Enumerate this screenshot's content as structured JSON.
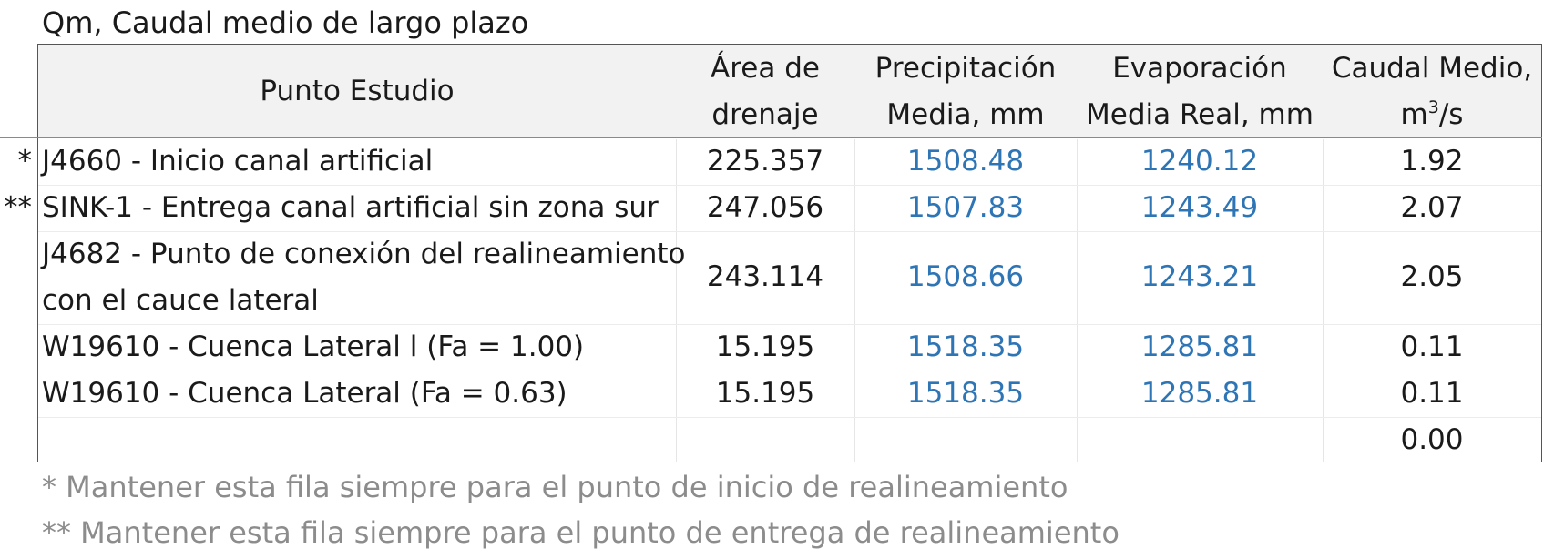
{
  "title": "Qm, Caudal medio de largo plazo",
  "headers": {
    "point": "Punto Estudio",
    "area_line1": "Área de",
    "area_line2": "drenaje",
    "precip_line1": "Precipitación",
    "precip_line2": "Media, mm",
    "evap_line1": "Evaporación",
    "evap_line2": "Media Real, mm",
    "flow_line1": "Caudal Medio,",
    "flow_unit_base": "m",
    "flow_unit_sup": "3",
    "flow_unit_tail": "/s"
  },
  "rows": [
    {
      "marker": "*",
      "point": "J4660 - Inicio canal artificial",
      "area": "225.357",
      "precip": "1508.48",
      "evap": "1240.12",
      "flow": "1.92"
    },
    {
      "marker": "**",
      "point": "SINK-1 - Entrega canal artificial sin zona sur",
      "area": "247.056",
      "precip": "1507.83",
      "evap": "1243.49",
      "flow": "2.07"
    },
    {
      "marker": "",
      "point_line1": "J4682 - Punto de conexión del realineamiento",
      "point_line2": "con el cauce lateral",
      "area": "243.114",
      "precip": "1508.66",
      "evap": "1243.21",
      "flow": "2.05"
    },
    {
      "marker": "",
      "point": "W19610 - Cuenca Lateral l (Fa = 1.00)",
      "area": "15.195",
      "precip": "1518.35",
      "evap": "1285.81",
      "flow": "0.11"
    },
    {
      "marker": "",
      "point": "W19610 - Cuenca Lateral (Fa = 0.63)",
      "area": "15.195",
      "precip": "1518.35",
      "evap": "1285.81",
      "flow": "0.11"
    },
    {
      "marker": "",
      "point": "",
      "area": "",
      "precip": "",
      "evap": "",
      "flow": "0.00"
    }
  ],
  "notes": [
    "* Mantener esta fila siempre para el punto de inicio de realineamiento",
    "** Mantener esta fila siempre para el punto de entrega de realineamiento"
  ],
  "colors": {
    "header_background": "#f2f2f2",
    "linked_value_text": "#2e75b6",
    "note_text": "#8c8c8c"
  }
}
